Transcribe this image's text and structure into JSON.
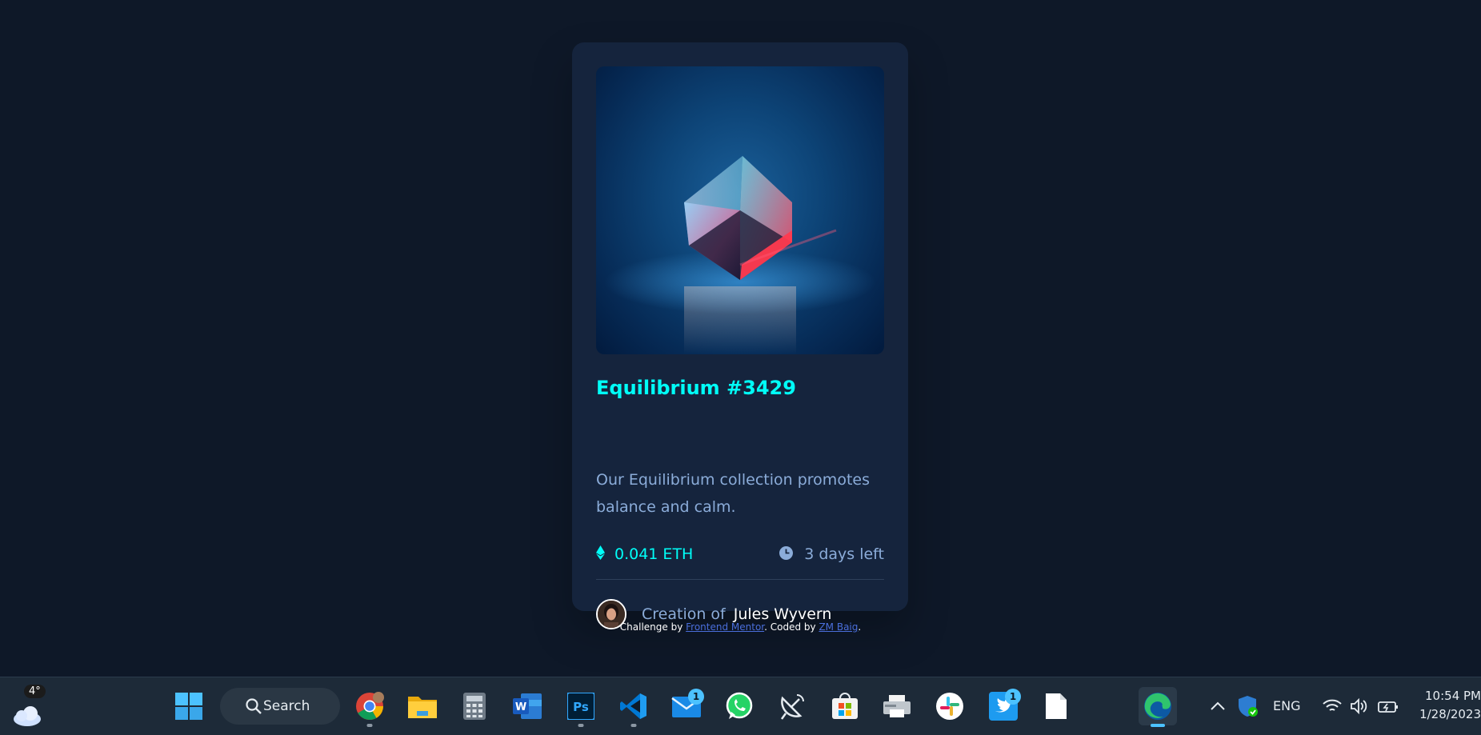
{
  "card": {
    "title": "Equilibrium #3429",
    "description": "Our Equilibrium collection promotes balance and calm.",
    "price": "0.041 ETH",
    "time_left": "3 days left",
    "creator_prefix": "Creation of",
    "creator_name": "Jules Wyvern"
  },
  "attribution": {
    "prefix": "Challenge by",
    "challenge_link": "Frontend Mentor",
    "middle": ". Coded by",
    "author_link": "ZM Baig",
    "suffix": "."
  },
  "taskbar": {
    "weather_temp": "4°",
    "search_label": "Search",
    "mail_badge": "1",
    "twitter_badge": "1",
    "language": "ENG",
    "time": "10:54 PM",
    "date": "1/28/2023"
  },
  "colors": {
    "page_bg": "#0e1828",
    "card_bg": "#15243d",
    "accent_cyan": "#00fff8",
    "soft_blue": "#8bacd9",
    "taskbar_bg": "#1d2a38"
  },
  "icons": [
    "ethereum-icon",
    "clock-icon",
    "weather-cloud-icon",
    "windows-start-icon",
    "search-icon",
    "chrome-icon",
    "file-explorer-icon",
    "calculator-icon",
    "word-icon",
    "photoshop-icon",
    "vscode-icon",
    "mail-icon",
    "whatsapp-icon",
    "satellite-icon",
    "microsoft-store-icon",
    "printer-icon",
    "slack-icon",
    "twitter-icon",
    "file-icon",
    "edge-icon",
    "chevron-up-icon",
    "security-shield-icon",
    "wifi-icon",
    "volume-icon",
    "battery-icon"
  ]
}
